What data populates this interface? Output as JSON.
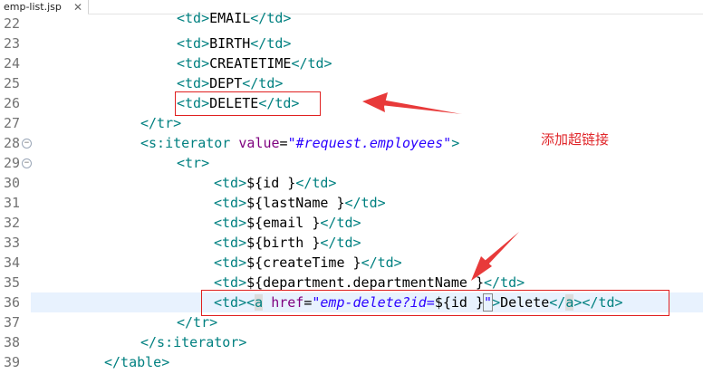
{
  "tab": {
    "title": "emp-list.jsp",
    "close_glyph": "✕"
  },
  "annotation": "添加超链接",
  "lines": {
    "22": {
      "num": "22",
      "text": "EMAIL"
    },
    "23": {
      "num": "23",
      "text": "BIRTH"
    },
    "24": {
      "num": "24",
      "text": "CREATETIME"
    },
    "25": {
      "num": "25",
      "text": "DEPT"
    },
    "26": {
      "num": "26",
      "text": "DELETE"
    },
    "27": {
      "num": "27"
    },
    "28": {
      "num": "28",
      "attr": "value",
      "value": "\"#request.employees\""
    },
    "29": {
      "num": "29"
    },
    "30": {
      "num": "30",
      "expr": "${id }"
    },
    "31": {
      "num": "31",
      "expr": "${lastName }"
    },
    "32": {
      "num": "32",
      "expr": "${email }"
    },
    "33": {
      "num": "33",
      "expr": "${birth }"
    },
    "34": {
      "num": "34",
      "expr": "${createTime }"
    },
    "35": {
      "num": "35",
      "expr": "${department.departmentName }"
    },
    "36": {
      "num": "36",
      "attr": "href",
      "value": "\"emp-delete?id=",
      "expr": "${id }",
      "close": "\"",
      "text": "Delete"
    },
    "37": {
      "num": "37"
    },
    "38": {
      "num": "38"
    },
    "39": {
      "num": "39"
    }
  },
  "colors": {
    "tag": "#008080",
    "attr": "#7f007f",
    "value": "#2a00ff",
    "annotation": "#e0262a",
    "current_line": "#e8f2fe"
  }
}
